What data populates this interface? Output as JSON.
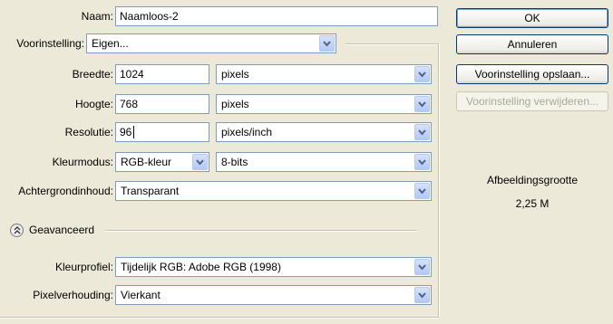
{
  "form": {
    "name_label": "Naam:",
    "name_value": "Naamloos-2",
    "preset_label": "Voorinstelling:",
    "preset_value": "Eigen...",
    "width_label": "Breedte:",
    "width_value": "1024",
    "width_unit": "pixels",
    "height_label": "Hoogte:",
    "height_value": "768",
    "height_unit": "pixels",
    "resolution_label": "Resolutie:",
    "resolution_value": "96",
    "resolution_unit": "pixels/inch",
    "colormode_label": "Kleurmodus:",
    "colormode_value": "RGB-kleur",
    "bitdepth_value": "8-bits",
    "background_label": "Achtergrondinhoud:",
    "background_value": "Transparant",
    "advanced_label": "Geavanceerd",
    "colorprofile_label": "Kleurprofiel:",
    "colorprofile_value": "Tijdelijk RGB:  Adobe RGB (1998)",
    "pixelratio_label": "Pixelverhouding:",
    "pixelratio_value": "Vierkant"
  },
  "buttons": {
    "ok": "OK",
    "cancel": "Annuleren",
    "save_preset": "Voorinstelling opslaan...",
    "delete_preset": "Voorinstelling verwijderen..."
  },
  "image_size": {
    "label": "Afbeeldingsgrootte",
    "value": "2,25 M"
  },
  "icons": {
    "dropdown": "chevron-down-icon",
    "advanced_toggle": "chevron-double-up-icon"
  },
  "colors": {
    "dialog_bg": "#ece9d8",
    "field_border": "#7f9db9",
    "button_border": "#003c74",
    "disabled_text": "#aca899"
  }
}
